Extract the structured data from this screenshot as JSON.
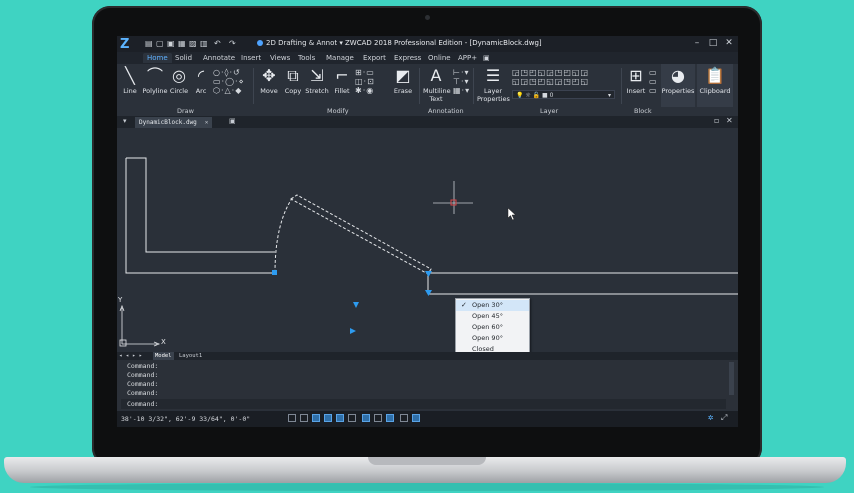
{
  "app": {
    "logo_glyph": "Z",
    "window_title": "ZWCAD 2018 Professional Edition - [DynamicBlock.dwg]",
    "workspace": "2D Drafting & Annot",
    "window_controls": {
      "minimize": "–",
      "restore": "□",
      "close": "✕"
    }
  },
  "quick_access": [
    "▤",
    "▢",
    "▣",
    "▦",
    "▨",
    "▥",
    "↶",
    "↷"
  ],
  "ribbon_tabs": [
    {
      "label": "Home",
      "active": true
    },
    {
      "label": "Solid"
    },
    {
      "label": "Annotate"
    },
    {
      "label": "Insert"
    },
    {
      "label": "Views"
    },
    {
      "label": "Tools"
    },
    {
      "label": "Manage"
    },
    {
      "label": "Export"
    },
    {
      "label": "Express"
    },
    {
      "label": "Online"
    },
    {
      "label": "APP+"
    }
  ],
  "ribbon": {
    "draw": {
      "line": "Line",
      "polyline": "Polyline",
      "circle": "Circle",
      "arc": "Arc"
    },
    "modify": {
      "move": "Move",
      "copy": "Copy",
      "stretch": "Stretch",
      "fillet": "Fillet",
      "erase": "Erase"
    },
    "annotation": {
      "multiline_text": "Multiline",
      "multiline_text2": "Text"
    },
    "layer": {
      "layer_properties": "Layer",
      "layer_properties2": "Properties",
      "current_layer": "0"
    },
    "block": {
      "insert": "Insert"
    },
    "properties": "Properties",
    "clipboard": "Clipboard",
    "panels": {
      "draw": "Draw",
      "modify": "Modify",
      "annotation": "Annotation",
      "layer": "Layer",
      "block": "Block"
    }
  },
  "document_tab": {
    "label": "DynamicBlock.dwg",
    "close": "✕"
  },
  "context_menu": {
    "items": [
      {
        "label": "Open 30°",
        "checked": true,
        "highlighted": true
      },
      {
        "label": "Open 45°"
      },
      {
        "label": "Open 60°"
      },
      {
        "label": "Open 90°"
      },
      {
        "label": "Closed"
      }
    ],
    "check_glyph": "✓"
  },
  "axes": {
    "x": "X",
    "y": "Y"
  },
  "layout_tabs": {
    "nav": "◂ ◂ ▸ ▸",
    "model": "Model",
    "layout1": "Layout1"
  },
  "command": {
    "history": [
      "Command:",
      "Command:",
      "Command:",
      "Command:"
    ],
    "prompt": "Command:"
  },
  "status_bar": {
    "coordinates": "38'-10 3/32\", 62'-9 33/64\", 0'-0\""
  },
  "colors": {
    "accent": "#5fb1ff",
    "block_line": "#e6e8eb",
    "grip": "#2d9bf0",
    "crosshair": "#d9484a"
  }
}
